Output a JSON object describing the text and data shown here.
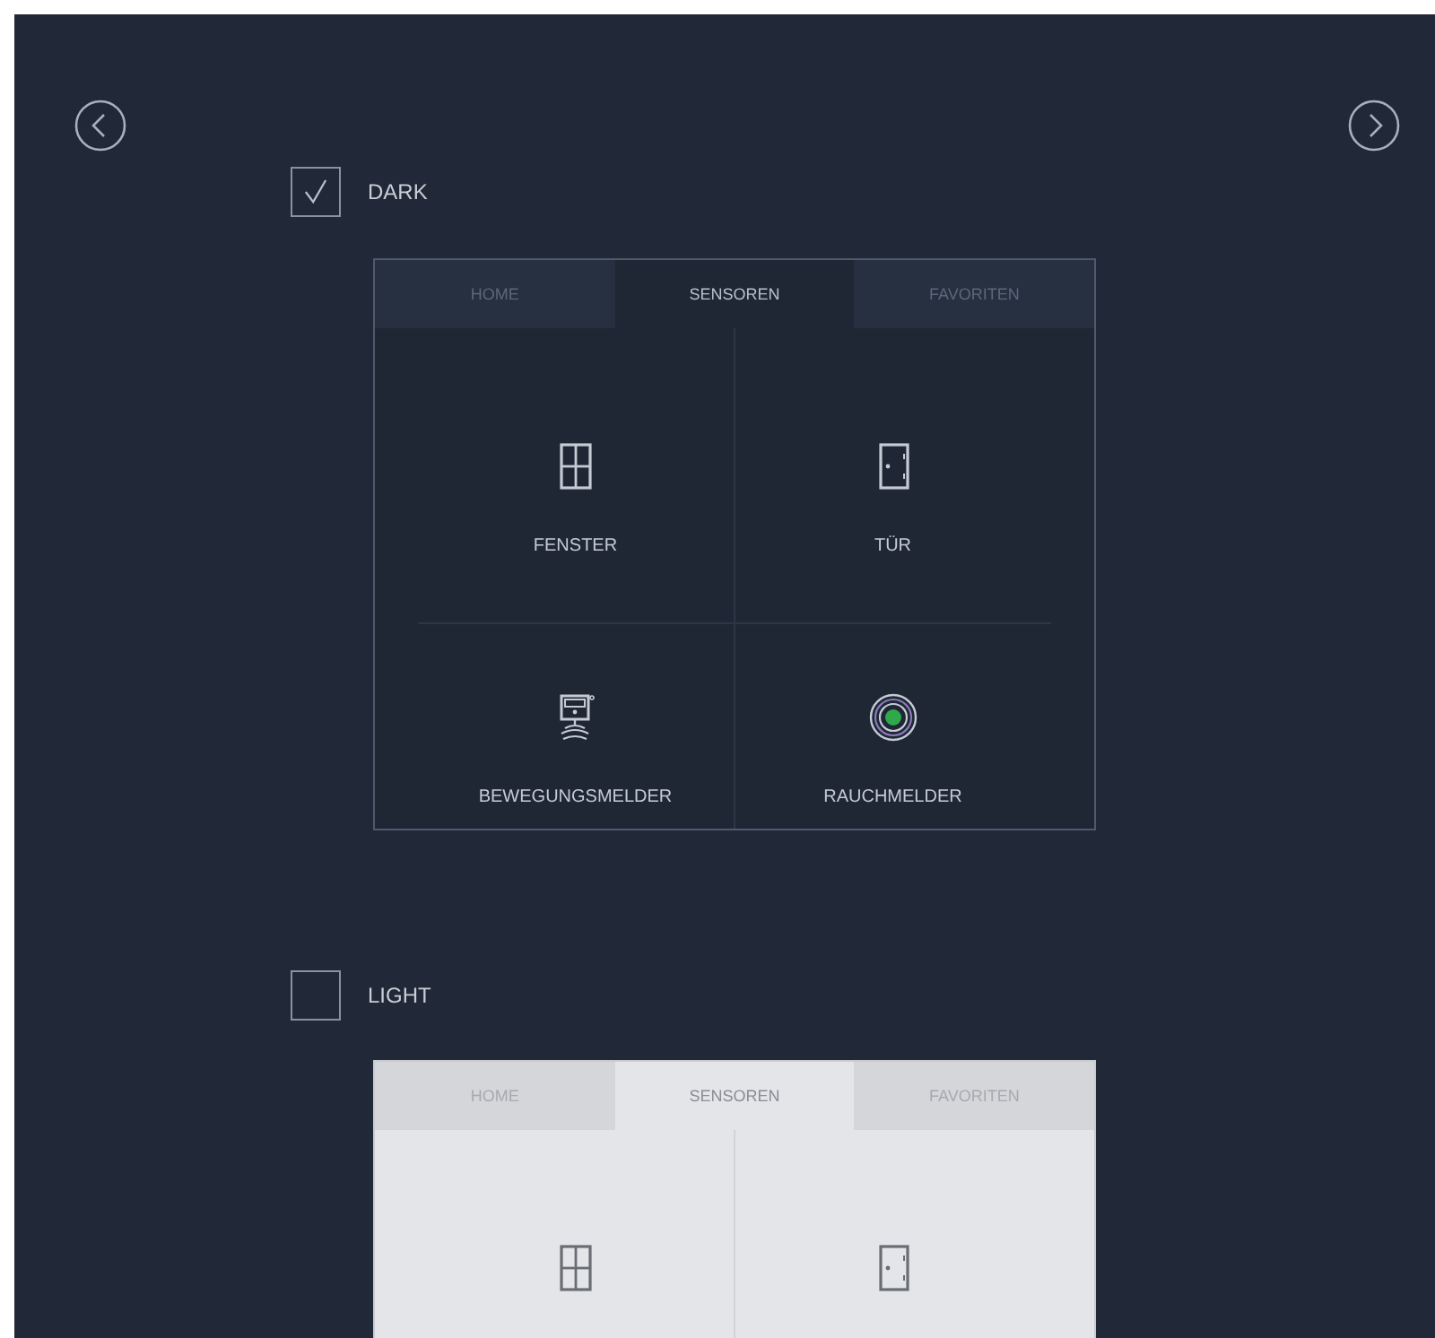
{
  "themes": [
    {
      "kind": "dark",
      "label": "DARK",
      "checked": true,
      "tabs": [
        {
          "label": "HOME",
          "selected": false
        },
        {
          "label": "SENSOREN",
          "selected": true
        },
        {
          "label": "FAVORITEN",
          "selected": false
        }
      ],
      "tiles": [
        {
          "kind": "window",
          "label": "FENSTER"
        },
        {
          "kind": "door",
          "label": "TÜR"
        },
        {
          "kind": "motion",
          "label": "BEWEGUNGSMELDER"
        },
        {
          "kind": "smoke",
          "label": "RAUCHMELDER"
        }
      ]
    },
    {
      "kind": "light",
      "label": "LIGHT",
      "checked": false,
      "tabs": [
        {
          "label": "HOME",
          "selected": false
        },
        {
          "label": "SENSOREN",
          "selected": true
        },
        {
          "label": "FAVORITEN",
          "selected": false
        }
      ],
      "tiles": [
        {
          "kind": "window"
        },
        {
          "kind": "door"
        }
      ]
    }
  ]
}
